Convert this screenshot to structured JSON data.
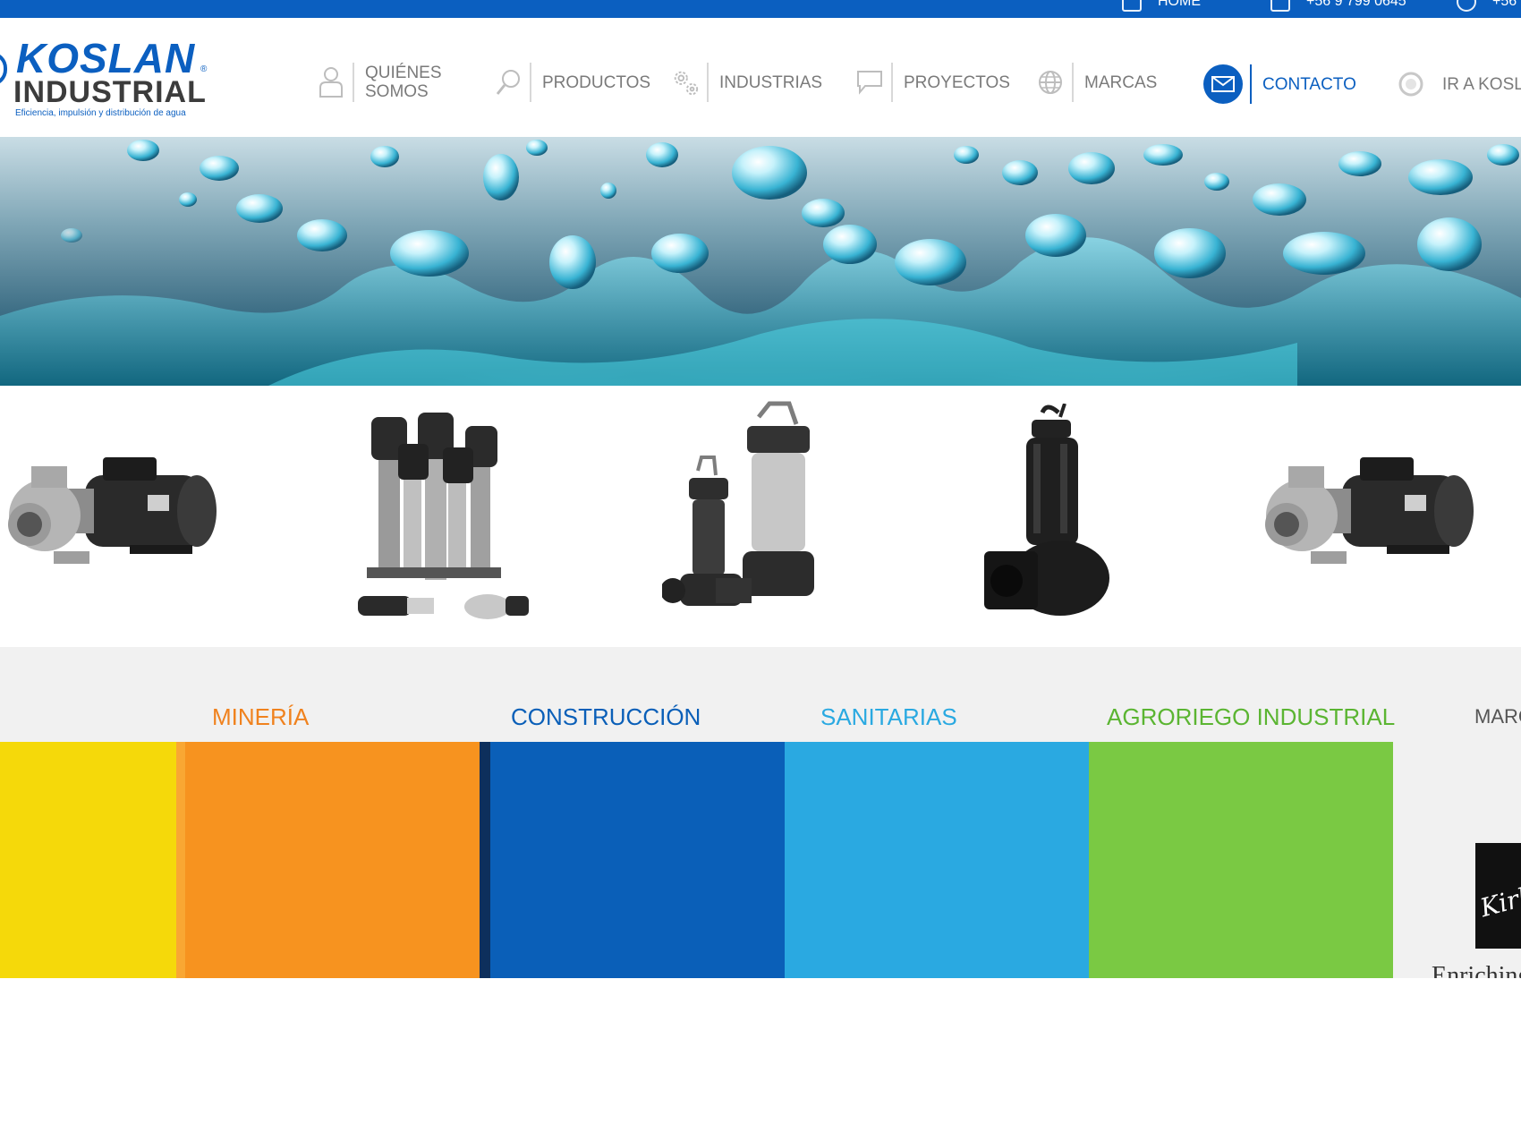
{
  "topbar": {
    "home_label": "HOME",
    "phone_1": "+56 9 799 0645",
    "phone_2": "+56"
  },
  "logo": {
    "brand": "KOSLAN",
    "registered": "®",
    "line2": "INDUSTRIAL",
    "tagline": "Eficiencia, impulsión y distribución de agua"
  },
  "nav": {
    "quienes_somos": "QUIÉNES\nSOMOS",
    "productos": "PRODUCTOS",
    "industrias": "INDUSTRIAS",
    "proyectos": "PROYECTOS",
    "marcas": "MARCAS",
    "contacto": "CONTACTO",
    "ir_a": "IR A KOSLAN"
  },
  "icons": {
    "quienes": "person-icon",
    "productos": "search-icon",
    "industrias": "gears-icon",
    "proyectos": "chat-icon",
    "marcas": "globe-icon",
    "contacto": "mail-icon",
    "ir_a": "koslan-icon"
  },
  "sectors": [
    {
      "title": "",
      "color": "#f5d90a"
    },
    {
      "title": "MINERÍA",
      "color": "#f7931f",
      "title_color": "#f0821e"
    },
    {
      "title": "CONSTRUCCIÓN",
      "color": "#0a5fb8",
      "title_color": "#0a5fb8"
    },
    {
      "title": "SANITARIAS",
      "color": "#2aa9e1",
      "title_color": "#2aa9e1"
    },
    {
      "title": "AGRORIEGO INDUSTRIAL",
      "color": "#7ac943",
      "title_color": "#5bb532"
    }
  ],
  "marcas": {
    "title": "MARCAS",
    "brand_logo_text": "Kirloskar",
    "brand_tagline": "Enriching Lives"
  }
}
